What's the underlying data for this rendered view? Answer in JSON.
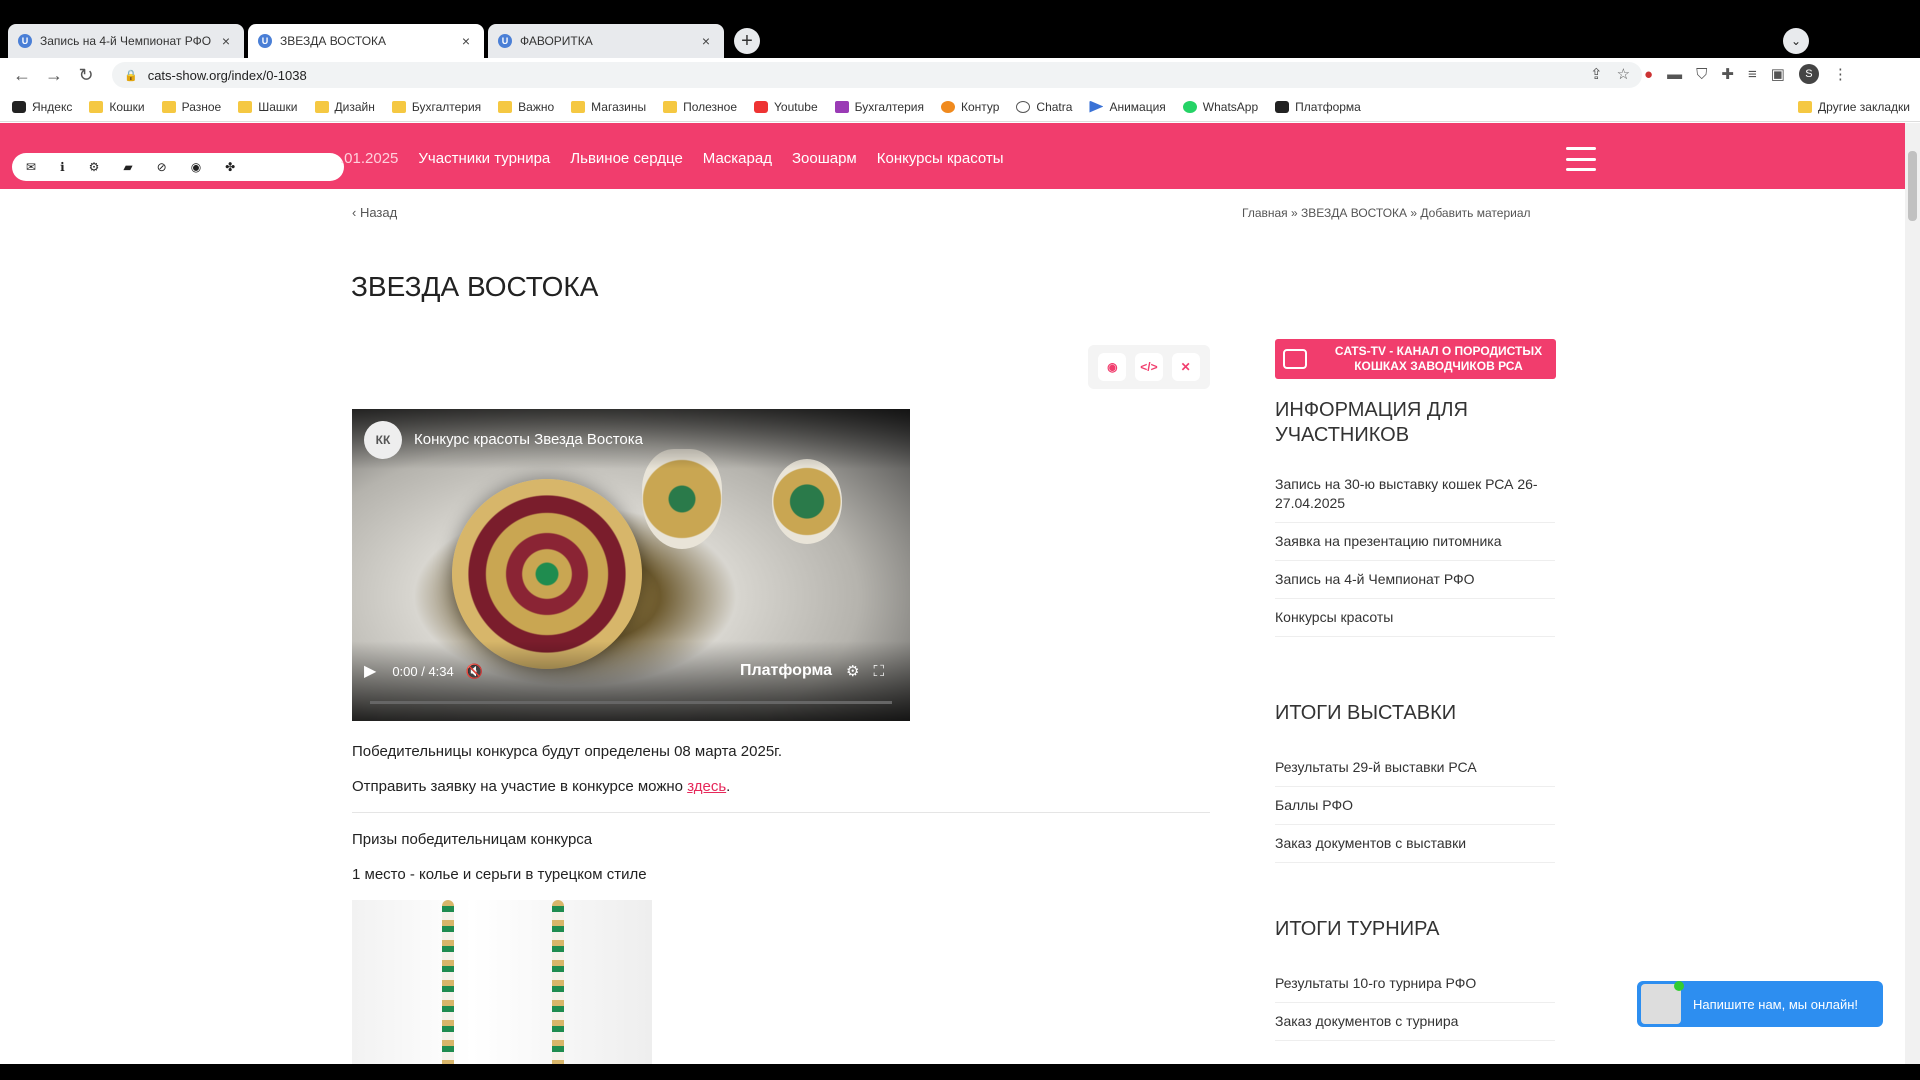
{
  "tabs": [
    {
      "title": "Запись на 4-й Чемпионат РФО",
      "favicon": "U",
      "active": false
    },
    {
      "title": "ЗВЕЗДА ВОСТОКА",
      "favicon": "U",
      "active": true
    },
    {
      "title": "ФАВОРИТКА",
      "favicon": "U",
      "active": false
    }
  ],
  "browser": {
    "url": "cats-show.org/index/0-1038",
    "profile_initial": "S",
    "new_tab": "+",
    "close": "×"
  },
  "bookmarks": [
    {
      "label": "Яндекс",
      "icon": "dark"
    },
    {
      "label": "Кошки",
      "icon": "folder"
    },
    {
      "label": "Разное",
      "icon": "folder"
    },
    {
      "label": "Шашки",
      "icon": "folder"
    },
    {
      "label": "Дизайн",
      "icon": "folder"
    },
    {
      "label": "Бухгалтерия",
      "icon": "folder"
    },
    {
      "label": "Важно",
      "icon": "folder"
    },
    {
      "label": "Магазины",
      "icon": "folder"
    },
    {
      "label": "Полезное",
      "icon": "folder"
    },
    {
      "label": "Youtube",
      "icon": "yt"
    },
    {
      "label": "Бухгалтерия",
      "icon": "pur"
    },
    {
      "label": "Контур",
      "icon": "org"
    },
    {
      "label": "Chatra",
      "icon": "chat"
    },
    {
      "label": "Анимация",
      "icon": "blue"
    },
    {
      "label": "WhatsApp",
      "icon": "wa"
    },
    {
      "label": "Платформа",
      "icon": "dark"
    }
  ],
  "other_bookmarks": "Другие закладки",
  "site": {
    "nav": [
      ".01.2025",
      "Участники турнира",
      "Львиное сердце",
      "Маскарад",
      "Зоошарм",
      "Конкурсы красоты"
    ],
    "admin_icons": [
      "mail-icon",
      "info-icon",
      "settings-icon",
      "folder-icon",
      "block-icon",
      "eye-icon",
      "puzzle-icon"
    ],
    "back": "Назад",
    "breadcrumb": "Главная » ЗВЕЗДА ВОСТОКА » Добавить материал",
    "title": "ЗВЕЗДА ВОСТОКА"
  },
  "video": {
    "channel": "КК",
    "title": "Конкурс красоты Звезда Востока",
    "time": "0:00 / 4:34",
    "brand": "Платформа",
    "progress": 0
  },
  "content": {
    "p1": "Победительницы конкурса будут определены 08 марта 2025г.",
    "p2_text": "Отправить заявку на участие в конкурсе можно ",
    "p2_link": "здесь",
    "p2_end": ".",
    "prizes_title": "Призы победительницам конкурса",
    "prize1": "1 место - колье и серьги в турецком стиле"
  },
  "sidebar": {
    "banner": "CATS-TV - КАНАЛ О ПОРОДИСТЫХ КОШКАХ ЗАВОДЧИКОВ РСА",
    "info_head": "ИНФОРМАЦИЯ ДЛЯ УЧАСТНИКОВ",
    "info_items": [
      "Запись на 30-ю выставку кошек РСА 26-27.04.2025",
      "Заявка на презентацию питомника",
      "Запись на 4-й Чемпионат РФО",
      "Конкурсы красоты"
    ],
    "results_head": "ИТОГИ ВЫСТАВКИ",
    "results_items": [
      "Результаты 29-й выставки РСА",
      "Баллы РФО",
      "Заказ документов с выставки"
    ],
    "tour_head": "ИТОГИ ТУРНИРА",
    "tour_items": [
      "Результаты 10-го турнира РФО",
      "Заказ документов с турнира"
    ]
  },
  "chat": {
    "label": "Напишите нам, мы онлайн!"
  },
  "colors": {
    "brand_pink": "#f13d6d",
    "link": "#e6285a",
    "chat_blue": "#2d8ef0"
  }
}
